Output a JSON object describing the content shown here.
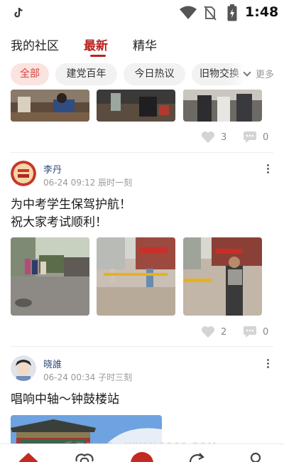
{
  "status_bar": {
    "time": "1:48"
  },
  "top_tabs": [
    {
      "label": "我的社区"
    },
    {
      "label": "最新",
      "active": true
    },
    {
      "label": "精华"
    }
  ],
  "filters": {
    "chips": [
      {
        "label": "全部",
        "active": true
      },
      {
        "label": "建党百年"
      },
      {
        "label": "今日热议"
      },
      {
        "label": "旧物交换"
      }
    ],
    "more_label": "更多"
  },
  "posts": [
    {
      "partial": true,
      "photo_count": 3,
      "likes": "3",
      "comments": "0"
    },
    {
      "user": "李丹",
      "time": "06-24 09:12 辰时一刻",
      "text_lines": [
        "为中考学生保驾护航！",
        "祝大家考试顺利！"
      ],
      "photo_count": 3,
      "likes": "2",
      "comments": "0"
    },
    {
      "user": "晓誰",
      "time": "06-24 00:34 子时三刻",
      "text_lines": [
        "唱响中轴～钟鼓楼站"
      ],
      "photo_count": 1
    }
  ],
  "watermark": "手游5566 · WWW.5566.COM",
  "colors": {
    "accent": "#b8231e",
    "chip_active_bg": "#fbe3df",
    "chip_active_text": "#d8443a"
  },
  "icons": {
    "status_left": "tiktok-icon",
    "status_right": [
      "wifi-icon",
      "no-sim-icon",
      "battery-icon"
    ],
    "post": [
      "heart-icon",
      "comment-icon",
      "more-vertical-icon"
    ],
    "bottom_nav": [
      "home-icon",
      "heart-outline-icon",
      "center-button",
      "refresh-icon",
      "profile-icon"
    ]
  }
}
